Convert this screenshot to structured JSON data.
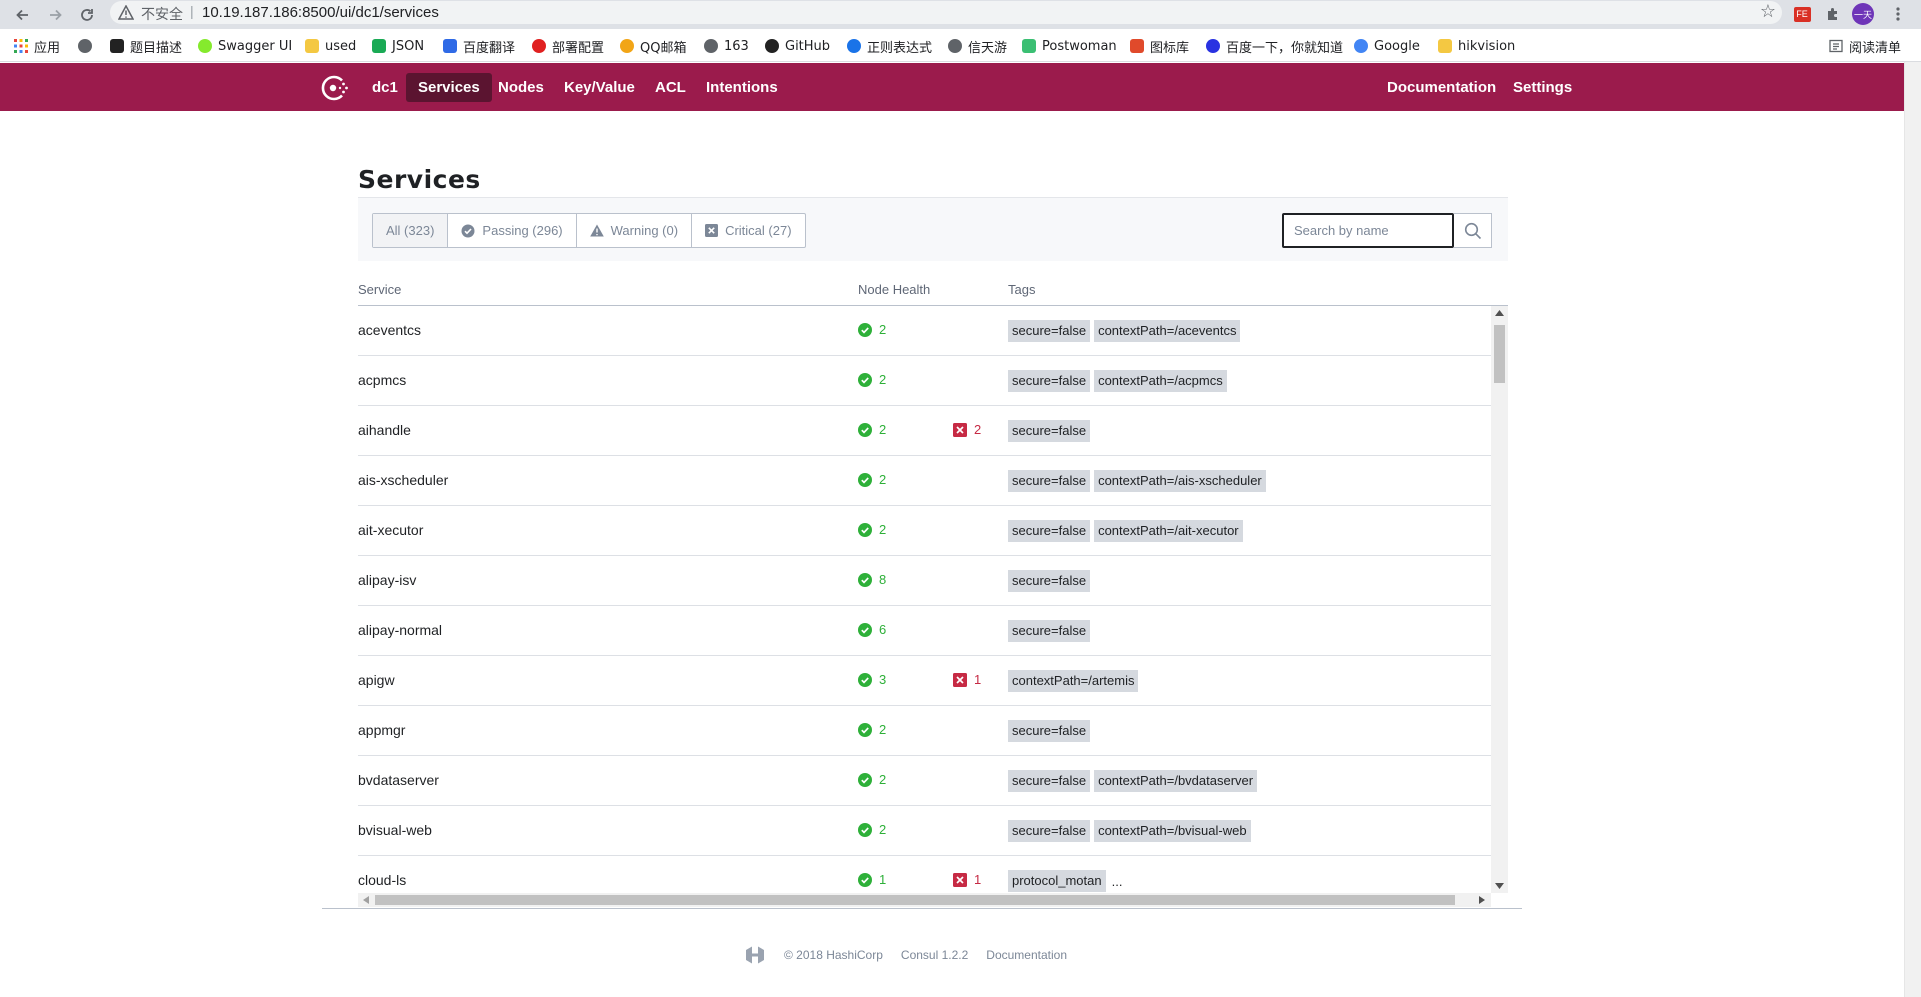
{
  "browser": {
    "address": {
      "insecure_label": "不安全",
      "separator": "|",
      "url": "10.19.187.186:8500/ui/dc1/services"
    },
    "bookmarks": [
      {
        "label": "应用",
        "color": "#e8453c"
      },
      {
        "label": "",
        "color": "#5f6368"
      },
      {
        "label": "题目描述",
        "color": "#222222"
      },
      {
        "label": "Swagger UI",
        "color": "#85ea2d"
      },
      {
        "label": "used",
        "color": "#f4c842"
      },
      {
        "label": "JSON",
        "color": "#1aaa55"
      },
      {
        "label": "百度翻译",
        "color": "#2f6ae6"
      },
      {
        "label": "部署配置",
        "color": "#e02020"
      },
      {
        "label": "QQ邮箱",
        "color": "#f2a516"
      },
      {
        "label": "163",
        "color": "#5f6368"
      },
      {
        "label": "GitHub",
        "color": "#222222"
      },
      {
        "label": "正则表达式",
        "color": "#1a73e8"
      },
      {
        "label": "信天游",
        "color": "#5f6368"
      },
      {
        "label": "Postwoman",
        "color": "#3bbf73"
      },
      {
        "label": "图标库",
        "color": "#e04a2b"
      },
      {
        "label": "百度一下，你就知道",
        "color": "#2932e1"
      },
      {
        "label": "Google",
        "color": "#4285f4"
      },
      {
        "label": "hikvision",
        "color": "#f4c842"
      }
    ],
    "reading_list": "阅读清单",
    "profile_initial": "一天"
  },
  "header": {
    "datacenter": "dc1",
    "nav": [
      "Services",
      "Nodes",
      "Key/Value",
      "ACL",
      "Intentions"
    ],
    "active_nav": "Services",
    "right_nav": [
      "Documentation",
      "Settings"
    ],
    "brand_color": "#9b1b4c"
  },
  "page": {
    "title": "Services",
    "filters": [
      {
        "label": "All (323)",
        "icon": "none",
        "selected": true
      },
      {
        "label": "Passing (296)",
        "icon": "check-circle-icon"
      },
      {
        "label": "Warning (0)",
        "icon": "warning-icon"
      },
      {
        "label": "Critical (27)",
        "icon": "cross-box-icon"
      }
    ],
    "search_placeholder": "Search by name",
    "columns": {
      "service": "Service",
      "health": "Node Health",
      "tags": "Tags"
    }
  },
  "services": [
    {
      "name": "aceventcs",
      "passing": "2",
      "critical": "",
      "tags": [
        "secure=false",
        "contextPath=/aceventcs"
      ],
      "more": ""
    },
    {
      "name": "acpmcs",
      "passing": "2",
      "critical": "",
      "tags": [
        "secure=false",
        "contextPath=/acpmcs"
      ],
      "more": ""
    },
    {
      "name": "aihandle",
      "passing": "2",
      "critical": "2",
      "tags": [
        "secure=false"
      ],
      "more": ""
    },
    {
      "name": "ais-xscheduler",
      "passing": "2",
      "critical": "",
      "tags": [
        "secure=false",
        "contextPath=/ais-xscheduler"
      ],
      "more": ""
    },
    {
      "name": "ait-xecutor",
      "passing": "2",
      "critical": "",
      "tags": [
        "secure=false",
        "contextPath=/ait-xecutor"
      ],
      "more": ""
    },
    {
      "name": "alipay-isv",
      "passing": "8",
      "critical": "",
      "tags": [
        "secure=false"
      ],
      "more": ""
    },
    {
      "name": "alipay-normal",
      "passing": "6",
      "critical": "",
      "tags": [
        "secure=false"
      ],
      "more": ""
    },
    {
      "name": "apigw",
      "passing": "3",
      "critical": "1",
      "tags": [
        "contextPath=/artemis"
      ],
      "more": ""
    },
    {
      "name": "appmgr",
      "passing": "2",
      "critical": "",
      "tags": [
        "secure=false"
      ],
      "more": ""
    },
    {
      "name": "bvdataserver",
      "passing": "2",
      "critical": "",
      "tags": [
        "secure=false",
        "contextPath=/bvdataserver"
      ],
      "more": ""
    },
    {
      "name": "bvisual-web",
      "passing": "2",
      "critical": "",
      "tags": [
        "secure=false",
        "contextPath=/bvisual-web"
      ],
      "more": ""
    },
    {
      "name": "cloud-ls",
      "passing": "1",
      "critical": "1",
      "tags": [
        "protocol_motan"
      ],
      "more": "..."
    }
  ],
  "footer": {
    "copyright": "© 2018 HashiCorp",
    "version": "Consul 1.2.2",
    "docs": "Documentation"
  },
  "colors": {
    "passing": "#2eb039",
    "critical": "#c62a44",
    "tag_bg": "#d5d9df"
  }
}
